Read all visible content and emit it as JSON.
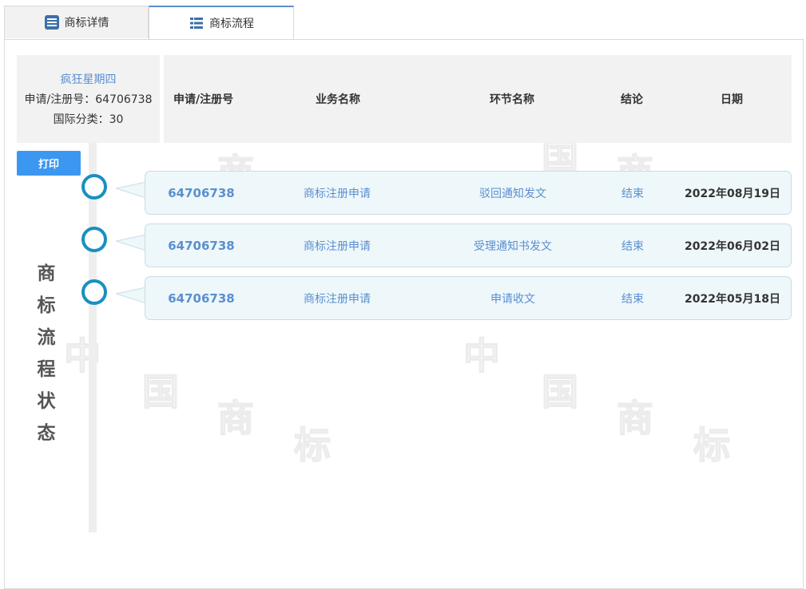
{
  "tabs": [
    {
      "label": "商标详情",
      "icon": "document-list-icon"
    },
    {
      "label": "商标流程",
      "icon": "table-list-icon"
    }
  ],
  "info": {
    "name": "疯狂星期四",
    "reg_number": "申请/注册号：64706738",
    "intl_class": "国际分类：30"
  },
  "columns": [
    "申请/注册号",
    "业务名称",
    "环节名称",
    "结论",
    "日期"
  ],
  "print_label": "打印",
  "vertical_title": [
    "商",
    "标",
    "流",
    "程",
    "状",
    "态"
  ],
  "rows": [
    {
      "number": "64706738",
      "business": "商标注册申请",
      "stage": "驳回通知发文",
      "result": "结束",
      "date": "2022年08月19日"
    },
    {
      "number": "64706738",
      "business": "商标注册申请",
      "stage": "受理通知书发文",
      "result": "结束",
      "date": "2022年06月02日"
    },
    {
      "number": "64706738",
      "business": "商标注册申请",
      "stage": "申请收文",
      "result": "结束",
      "date": "2022年05月18日"
    }
  ],
  "colors": {
    "accent": "#3c97f0",
    "link": "#5b8fd0",
    "timeline_circle": "#1a8fc2"
  }
}
